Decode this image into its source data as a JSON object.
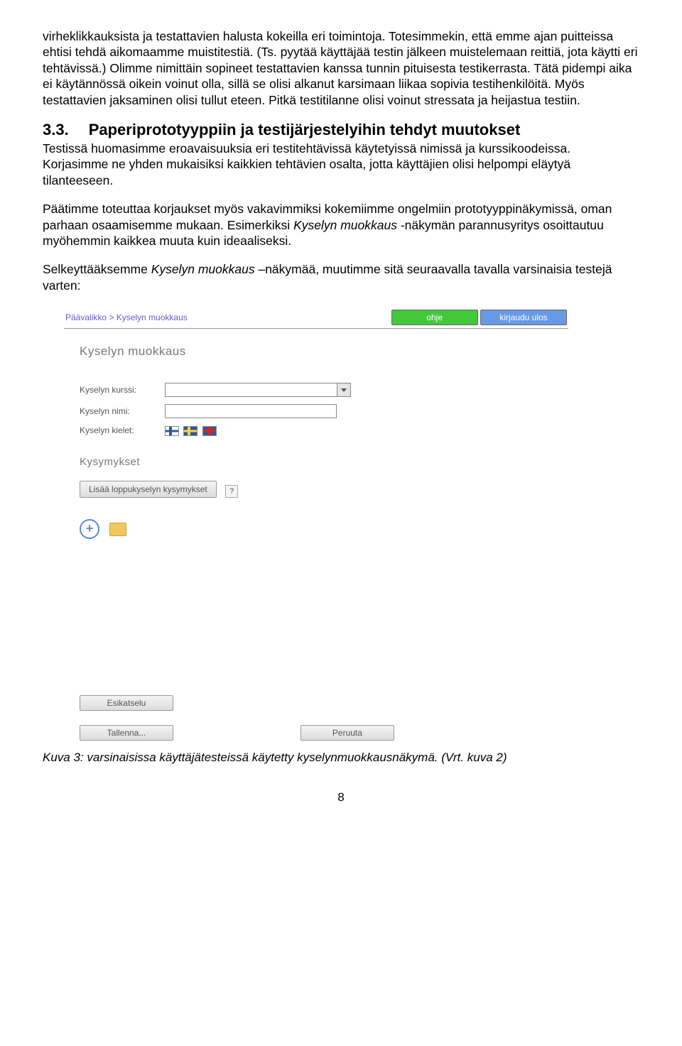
{
  "para1": "virheklikkauksista ja testattavien halusta kokeilla eri toimintoja. Totesimmekin, että emme ajan puitteissa ehtisi tehdä aikomaamme muistitestiä. (Ts. pyytää käyttäjää testin jälkeen muistelemaan reittiä, jota käytti eri tehtävissä.) Olimme nimittäin sopineet testattavien kanssa tunnin pituisesta testikerrasta. Tätä pidempi aika ei käytännössä oikein voinut olla, sillä se olisi alkanut karsimaan liikaa sopivia testihenkilöitä. Myös testattavien jaksaminen olisi tullut eteen. Pitkä testitilanne olisi voinut stressata ja heijastua testiin.",
  "section_num": "3.3.",
  "section_title": "Paperiprototyyppiin ja testijärjestelyihin tehdyt muutokset",
  "para2": "Testissä huomasimme eroavaisuuksia eri testitehtävissä käytetyissä nimissä ja kurssikoodeissa. Korjasimme ne yhden mukaisiksi kaikkien tehtävien osalta, jotta käyttäjien olisi helpompi eläytyä tilanteeseen.",
  "para3_a": "Päätimme toteuttaa korjaukset myös vakavimmiksi kokemiimme ongelmiin prototyyppinäkymissä, oman parhaan osaamisemme mukaan. Esimerkiksi ",
  "para3_i": "Kyselyn muokkaus",
  "para3_b": " -näkymän parannusyritys osoittautuu myöhemmin kaikkea muuta kuin ideaaliseksi.",
  "para4_a": "Selkeyttääksemme ",
  "para4_i": "Kyselyn muokkaus",
  "para4_b": " –näkymää, muutimme sitä seuraavalla tavalla varsinaisia testejä varten:",
  "mock": {
    "breadcrumb": "Päävalikko > Kyselyn muokkaus",
    "btn_help": "ohje",
    "btn_logout": "kirjaudu ulos",
    "h1": "Kyselyn muokkaus",
    "lab_course": "Kyselyn kurssi:",
    "lab_name": "Kyselyn nimi:",
    "lab_lang": "Kyselyn kielet:",
    "sub": "Kysymykset",
    "bigbtn": "Lisää loppukyselyn kysymykset",
    "help": "?",
    "preview": "Esikatselu",
    "save": "Tallenna...",
    "cancel": "Peruuta"
  },
  "caption": "Kuva 3: varsinaisissa käyttäjätesteissä käytetty kyselynmuokkausnäkymä. (Vrt. kuva 2)",
  "pagenum": "8"
}
